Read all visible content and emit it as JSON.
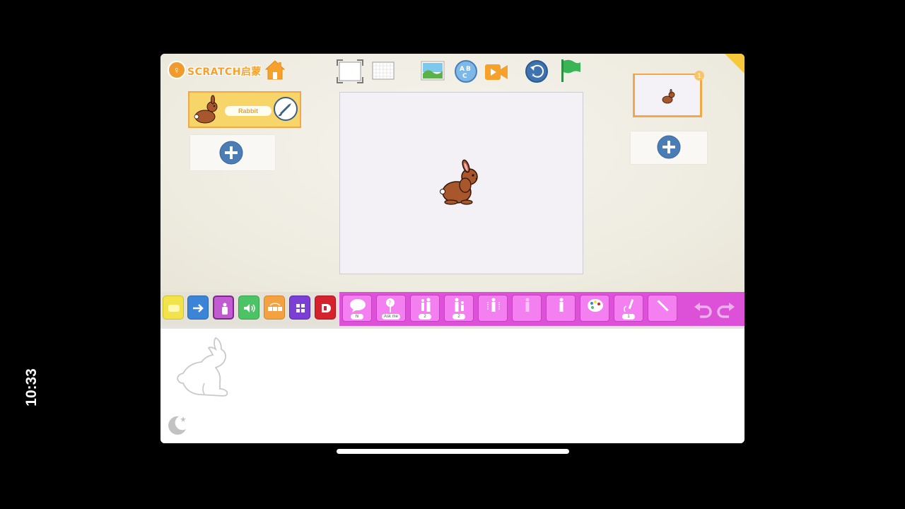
{
  "status_bar": {
    "time": "10:33"
  },
  "app": {
    "logo_text": "SCRATCH启蒙",
    "sprite": {
      "name": "Rabbit"
    },
    "page": {
      "number": "1"
    },
    "blocks": [
      {
        "icon": "say-icon",
        "label": "hi"
      },
      {
        "icon": "ask-icon",
        "label": "Ask me"
      },
      {
        "icon": "grow-icon",
        "label": "2"
      },
      {
        "icon": "shrink-icon",
        "label": "2"
      },
      {
        "icon": "reset-size-icon",
        "label": ""
      },
      {
        "icon": "hide-icon",
        "label": ""
      },
      {
        "icon": "show-icon",
        "label": ""
      },
      {
        "icon": "costume-icon",
        "label": ""
      },
      {
        "icon": "set-pen-icon",
        "label": "1"
      },
      {
        "icon": "pen-icon",
        "label": ""
      }
    ],
    "categories": [
      {
        "name": "events",
        "color": "#f3e34a"
      },
      {
        "name": "motion",
        "color": "#3c84d8"
      },
      {
        "name": "looks",
        "color": "#c25ad1"
      },
      {
        "name": "sound",
        "color": "#4cc465"
      },
      {
        "name": "control",
        "color": "#f4a142"
      },
      {
        "name": "extension",
        "color": "#7b3fd6"
      },
      {
        "name": "end",
        "color": "#d6222c"
      }
    ],
    "colors": {
      "block_bg": "#dd50d8",
      "block_fill": "#f37ff0",
      "sprite_card": "#f8d568",
      "plus_button": "#4a7db5",
      "flag": "#3ab556",
      "accent_orange": "#f5a12c"
    }
  }
}
